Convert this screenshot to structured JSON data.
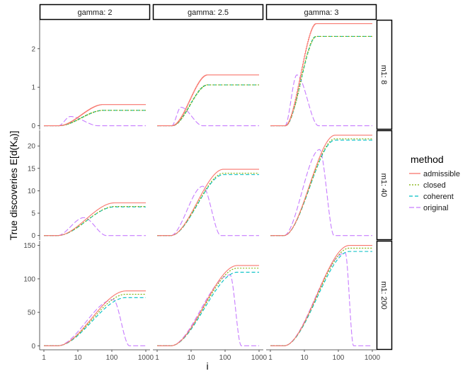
{
  "chart_data": {
    "type": "line",
    "title": "",
    "xlabel": "i",
    "ylabel": "True discoveries E[d(Kₐ)]",
    "x_scale": "log10",
    "xlim": [
      1,
      1000
    ],
    "x_ticks": [
      1,
      10,
      100,
      1000
    ],
    "x_tick_labels": [
      "1",
      "10",
      "100",
      "1000"
    ],
    "facet_columns": {
      "variable": "gamma",
      "labels": [
        "gamma: 2",
        "gamma: 2.5",
        "gamma: 3"
      ],
      "values": [
        2,
        2.5,
        3
      ]
    },
    "facet_rows": {
      "variable": "m1",
      "labels": [
        "m1: 8",
        "m1: 40",
        "m1: 200"
      ],
      "values": [
        8,
        40,
        200
      ]
    },
    "row_scales": [
      {
        "ylim": [
          -0.1,
          2.75
        ],
        "y_ticks": [
          0,
          1,
          2
        ]
      },
      {
        "ylim": [
          -1,
          23.5
        ],
        "y_ticks": [
          0,
          5,
          10,
          15,
          20
        ]
      },
      {
        "ylim": [
          -6,
          157
        ],
        "y_ticks": [
          0,
          50,
          100,
          150
        ]
      }
    ],
    "legend": {
      "title": "method",
      "placement": "right",
      "entries": [
        {
          "name": "admissible",
          "color": "#F8766D",
          "dash": "solid"
        },
        {
          "name": "closed",
          "color": "#7CAE00",
          "dash": "dotted"
        },
        {
          "name": "coherent",
          "color": "#00BFC4",
          "dash": "dashed"
        },
        {
          "name": "original",
          "color": "#C77CFF",
          "dash": "longdash"
        }
      ]
    },
    "grid": false,
    "panels": [
      {
        "row": "m1: 8",
        "col": "gamma: 2",
        "x0": 2.7,
        "x_end": 55,
        "plateau": {
          "admissible": 0.55,
          "closed": 0.4,
          "coherent": 0.4
        },
        "original": {
          "peak_x": 6,
          "peak_y": 0.24,
          "decay_x": 40
        }
      },
      {
        "row": "m1: 8",
        "col": "gamma: 2.5",
        "x0": 2.7,
        "x_end": 30,
        "plateau": {
          "admissible": 1.32,
          "closed": 1.06,
          "coherent": 1.06
        },
        "original": {
          "peak_x": 5,
          "peak_y": 0.48,
          "decay_x": 22
        }
      },
      {
        "row": "m1: 8",
        "col": "gamma: 3",
        "x0": 2.7,
        "x_end": 22,
        "plateau": {
          "admissible": 2.65,
          "closed": 2.32,
          "coherent": 2.32
        },
        "original": {
          "peak_x": 6,
          "peak_y": 1.32,
          "decay_x": 26
        }
      },
      {
        "row": "m1: 40",
        "col": "gamma: 2",
        "x0": 2.5,
        "x_end": 120,
        "plateau": {
          "admissible": 7.3,
          "closed": 6.5,
          "coherent": 6.4
        },
        "original": {
          "peak_x": 15,
          "peak_y": 4.0,
          "decay_x": 70
        }
      },
      {
        "row": "m1: 40",
        "col": "gamma: 2.5",
        "x0": 2.5,
        "x_end": 90,
        "plateau": {
          "admissible": 14.8,
          "closed": 13.9,
          "coherent": 13.6
        },
        "original": {
          "peak_x": 22,
          "peak_y": 11.0,
          "decay_x": 75
        }
      },
      {
        "row": "m1: 40",
        "col": "gamma: 3",
        "x0": 2.5,
        "x_end": 80,
        "plateau": {
          "admissible": 22.4,
          "closed": 21.6,
          "coherent": 21.3
        },
        "original": {
          "peak_x": 28,
          "peak_y": 19.2,
          "decay_x": 75
        }
      },
      {
        "row": "m1: 200",
        "col": "gamma: 2",
        "x0": 2.5,
        "x_end": 260,
        "plateau": {
          "admissible": 82,
          "closed": 77,
          "coherent": 72
        },
        "original": {
          "peak_x": 110,
          "peak_y": 69,
          "decay_x": 330
        }
      },
      {
        "row": "m1: 200",
        "col": "gamma: 2.5",
        "x0": 2.5,
        "x_end": 230,
        "plateau": {
          "admissible": 120,
          "closed": 116,
          "coherent": 110
        },
        "original": {
          "peak_x": 140,
          "peak_y": 106,
          "decay_x": 300
        }
      },
      {
        "row": "m1: 200",
        "col": "gamma: 3",
        "x0": 2.5,
        "x_end": 210,
        "plateau": {
          "admissible": 150,
          "closed": 146,
          "coherent": 141
        },
        "original": {
          "peak_x": 160,
          "peak_y": 139,
          "decay_x": 280
        }
      }
    ]
  }
}
